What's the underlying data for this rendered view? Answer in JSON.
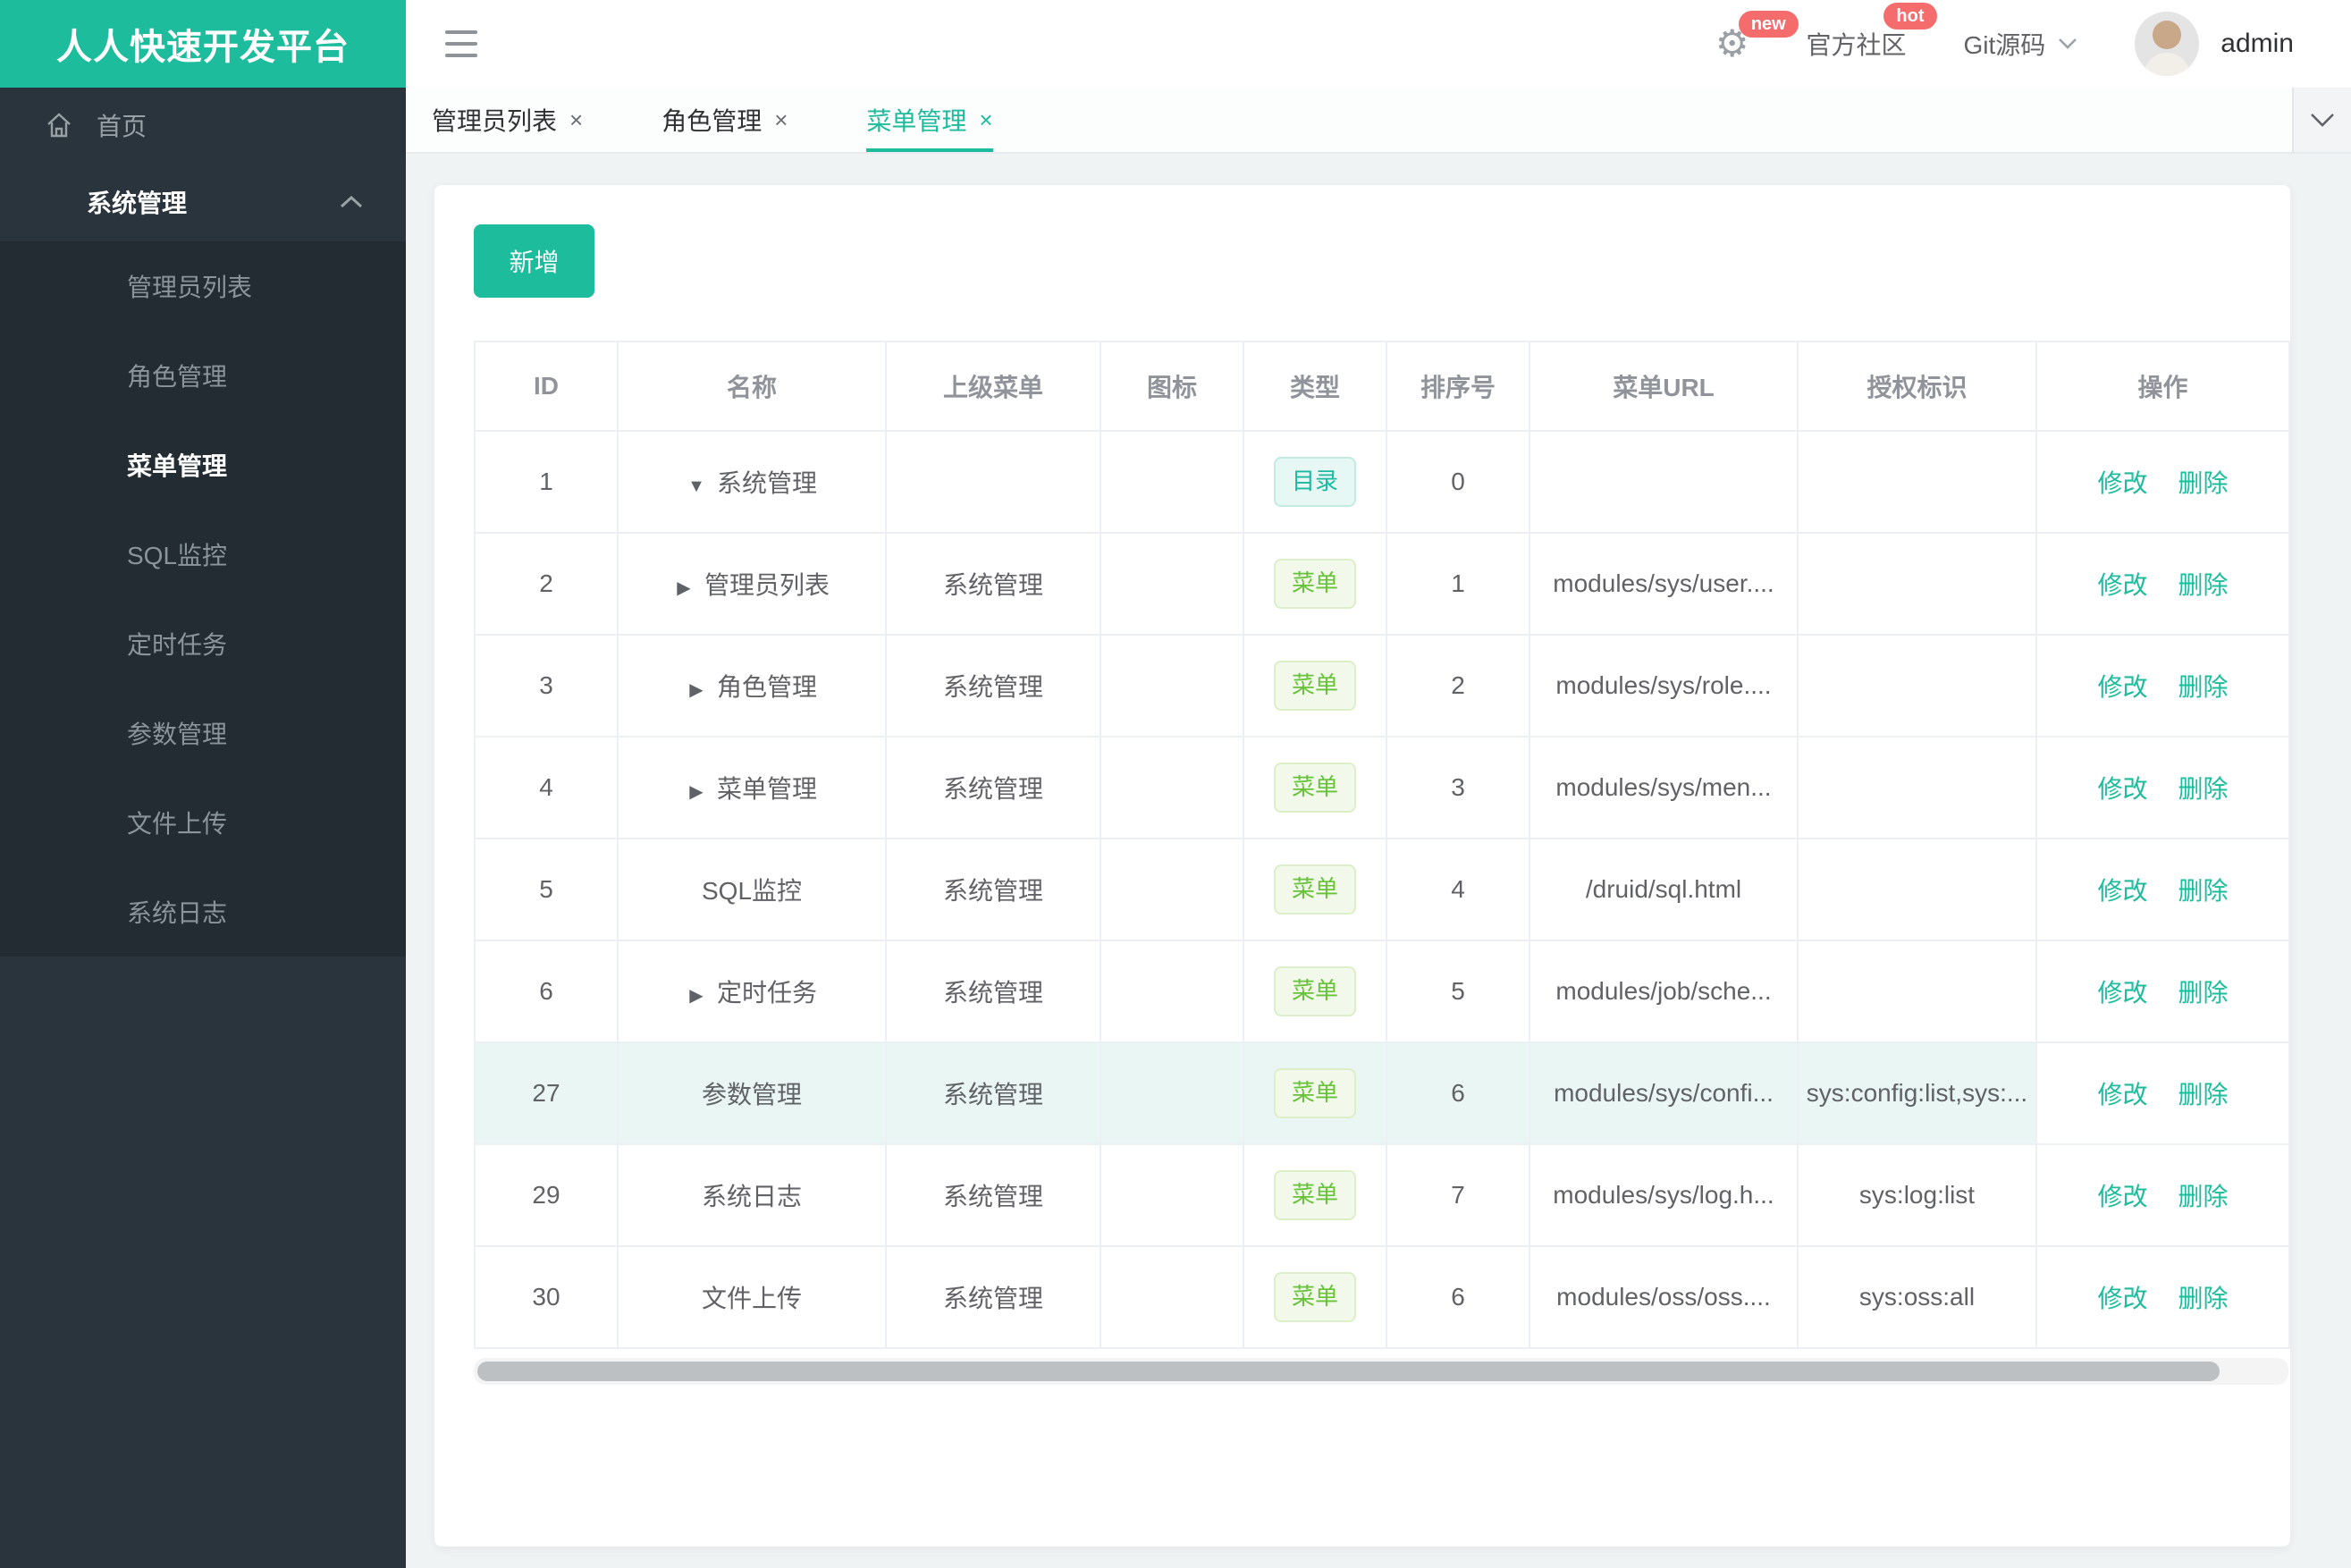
{
  "app": {
    "title": "人人快速开发平台"
  },
  "colors": {
    "primary": "#1CBC9C",
    "danger": "#F56C6C",
    "sidebar": "#2A343C",
    "submenu": "#232C33",
    "success": "#67C23A"
  },
  "sidebar": {
    "home": "首页",
    "group_label": "系统管理",
    "items": [
      {
        "label": "管理员列表"
      },
      {
        "label": "角色管理"
      },
      {
        "label": "菜单管理",
        "active": true
      },
      {
        "label": "SQL监控"
      },
      {
        "label": "定时任务"
      },
      {
        "label": "参数管理"
      },
      {
        "label": "文件上传"
      },
      {
        "label": "系统日志"
      }
    ]
  },
  "header": {
    "badge_new": "new",
    "community": "官方社区",
    "badge_hot": "hot",
    "git": "Git源码",
    "user": "admin"
  },
  "tabs": [
    {
      "label": "管理员列表",
      "close": "×"
    },
    {
      "label": "角色管理",
      "close": "×"
    },
    {
      "label": "菜单管理",
      "close": "×",
      "active": true
    }
  ],
  "toolbar": {
    "add_label": "新增"
  },
  "table": {
    "columns": [
      "ID",
      "名称",
      "上级菜单",
      "图标",
      "类型",
      "排序号",
      "菜单URL",
      "授权标识",
      "操作"
    ],
    "ops": {
      "edit": "修改",
      "delete": "删除"
    },
    "type_labels": {
      "dir": "目录",
      "menu": "菜单"
    },
    "rows": [
      {
        "id": "1",
        "caret": "down",
        "name": "系统管理",
        "parent": "",
        "type": "dir",
        "order": "0",
        "url": "",
        "perms": "",
        "highlight": false
      },
      {
        "id": "2",
        "caret": "right",
        "name": "管理员列表",
        "parent": "系统管理",
        "type": "menu",
        "order": "1",
        "url": "modules/sys/user....",
        "perms": "",
        "highlight": false
      },
      {
        "id": "3",
        "caret": "right",
        "name": "角色管理",
        "parent": "系统管理",
        "type": "menu",
        "order": "2",
        "url": "modules/sys/role....",
        "perms": "",
        "highlight": false
      },
      {
        "id": "4",
        "caret": "right",
        "name": "菜单管理",
        "parent": "系统管理",
        "type": "menu",
        "order": "3",
        "url": "modules/sys/men...",
        "perms": "",
        "highlight": false
      },
      {
        "id": "5",
        "caret": "",
        "name": "SQL监控",
        "parent": "系统管理",
        "type": "menu",
        "order": "4",
        "url": "/druid/sql.html",
        "perms": "",
        "highlight": false
      },
      {
        "id": "6",
        "caret": "right",
        "name": "定时任务",
        "parent": "系统管理",
        "type": "menu",
        "order": "5",
        "url": "modules/job/sche...",
        "perms": "",
        "highlight": false
      },
      {
        "id": "27",
        "caret": "",
        "name": "参数管理",
        "parent": "系统管理",
        "type": "menu",
        "order": "6",
        "url": "modules/sys/confi...",
        "perms": "sys:config:list,sys:...",
        "highlight": true
      },
      {
        "id": "29",
        "caret": "",
        "name": "系统日志",
        "parent": "系统管理",
        "type": "menu",
        "order": "7",
        "url": "modules/sys/log.h...",
        "perms": "sys:log:list",
        "highlight": false
      },
      {
        "id": "30",
        "caret": "",
        "name": "文件上传",
        "parent": "系统管理",
        "type": "menu",
        "order": "6",
        "url": "modules/oss/oss....",
        "perms": "sys:oss:all",
        "highlight": false
      }
    ]
  }
}
